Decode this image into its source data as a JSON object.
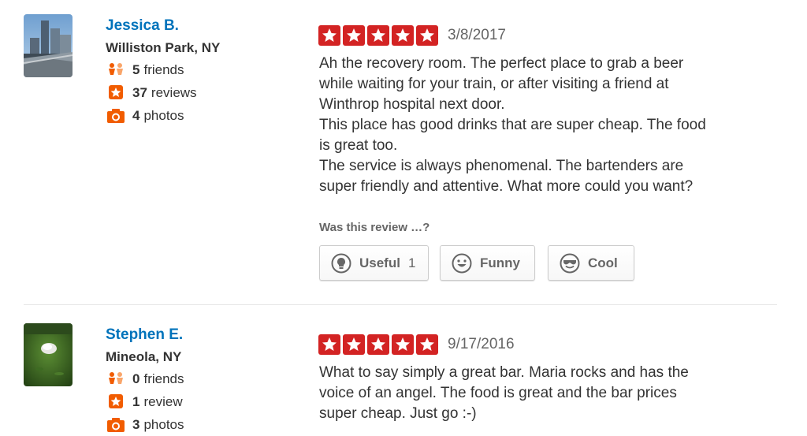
{
  "reviews": [
    {
      "user": {
        "name": "Jessica B.",
        "location": "Williston Park, NY",
        "friends_count": "5",
        "friends_label": "friends",
        "reviews_count": "37",
        "reviews_label": "reviews",
        "photos_count": "4",
        "photos_label": "photos"
      },
      "rating": 5,
      "date": "3/8/2017",
      "text_lines": [
        "Ah the recovery room. The perfect place to grab a beer",
        "while waiting for your train, or after visiting a friend at",
        "Winthrop hospital next door.",
        "This place has good drinks that are super cheap. The food",
        "is great too.",
        "The service is always phenomenal. The bartenders are",
        "super friendly and attentive. What more could you want?"
      ],
      "vote_question": "Was this review …?",
      "votes": {
        "useful_label": "Useful",
        "useful_count": "1",
        "funny_label": "Funny",
        "cool_label": "Cool"
      }
    },
    {
      "user": {
        "name": "Stephen E.",
        "location": "Mineola, NY",
        "friends_count": "0",
        "friends_label": "friends",
        "reviews_count": "1",
        "reviews_label": "review",
        "photos_count": "3",
        "photos_label": "photos"
      },
      "rating": 5,
      "date": "9/17/2016",
      "text_lines": [
        "What to say simply a great bar. Maria rocks and has the",
        "voice of an angel.  The food is great and the bar prices",
        "super cheap.  Just go :-)"
      ]
    }
  ],
  "colors": {
    "link": "#0073bb",
    "star_red": "#d32323",
    "stat_orange": "#f15c00"
  }
}
